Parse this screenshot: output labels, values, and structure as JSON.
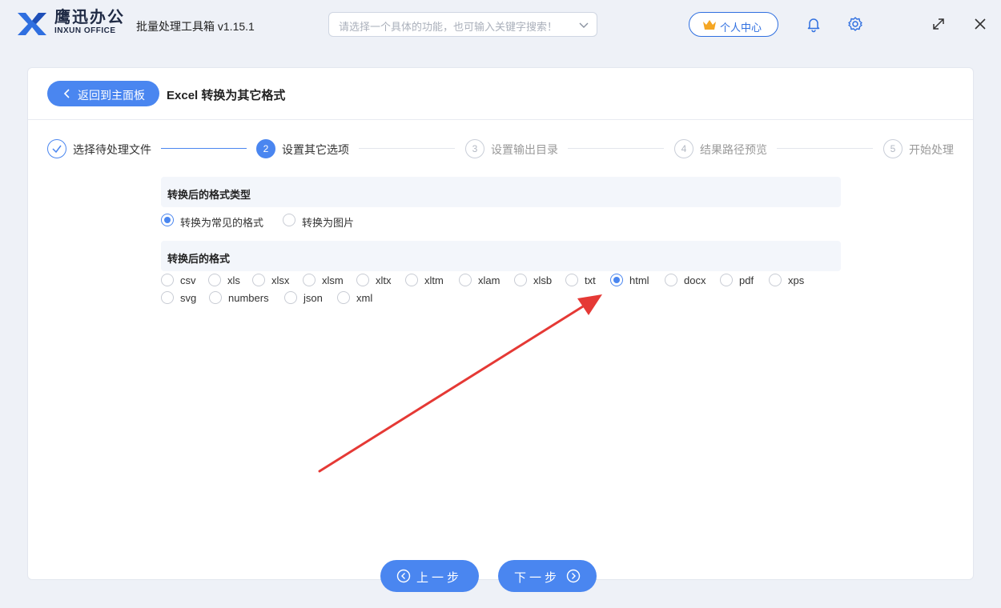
{
  "app": {
    "brand_cn": "鹰迅办公",
    "brand_en": "INXUN OFFICE",
    "title": "批量处理工具箱 v1.15.1",
    "accent_color": "#4a86f0",
    "annotation_arrow_color": "#e53935"
  },
  "search": {
    "placeholder": "请选择一个具体的功能，也可输入关键字搜索！"
  },
  "header": {
    "user_center": "个人中心"
  },
  "page": {
    "back_label": "返回到主面板",
    "title": "Excel 转换为其它格式"
  },
  "stepper": {
    "steps": [
      {
        "num": "",
        "label": "选择待处理文件",
        "state": "done"
      },
      {
        "num": "2",
        "label": "设置其它选项",
        "state": "active"
      },
      {
        "num": "3",
        "label": "设置输出目录",
        "state": "pending"
      },
      {
        "num": "4",
        "label": "结果路径预览",
        "state": "pending"
      },
      {
        "num": "5",
        "label": "开始处理",
        "state": "pending"
      }
    ]
  },
  "format_type": {
    "heading": "转换后的格式类型",
    "options": [
      {
        "label": "转换为常见的格式",
        "checked": true
      },
      {
        "label": "转换为图片",
        "checked": false
      }
    ]
  },
  "format": {
    "heading": "转换后的格式",
    "options": [
      {
        "label": "csv",
        "checked": false
      },
      {
        "label": "xls",
        "checked": false
      },
      {
        "label": "xlsx",
        "checked": false
      },
      {
        "label": "xlsm",
        "checked": false
      },
      {
        "label": "xltx",
        "checked": false
      },
      {
        "label": "xltm",
        "checked": false
      },
      {
        "label": "xlam",
        "checked": false
      },
      {
        "label": "xlsb",
        "checked": false
      },
      {
        "label": "txt",
        "checked": false
      },
      {
        "label": "html",
        "checked": true
      },
      {
        "label": "docx",
        "checked": false
      },
      {
        "label": "pdf",
        "checked": false
      },
      {
        "label": "xps",
        "checked": false
      },
      {
        "label": "svg",
        "checked": false
      },
      {
        "label": "numbers",
        "checked": false
      },
      {
        "label": "json",
        "checked": false
      },
      {
        "label": "xml",
        "checked": false
      }
    ]
  },
  "footer": {
    "prev_label": "上一步",
    "next_label": "下一步"
  }
}
